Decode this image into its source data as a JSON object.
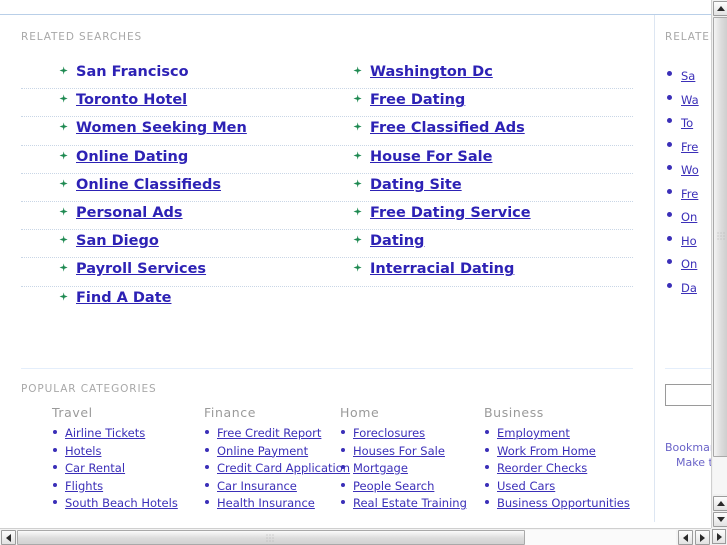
{
  "page": {
    "related_searches_label": "RELATED SEARCHES",
    "popular_categories_label": "POPULAR CATEGORIES"
  },
  "related_searches": {
    "left_column": [
      "San Francisco",
      "Toronto Hotel",
      "Women Seeking Men",
      "Online Dating",
      "Online Classifieds",
      "Personal Ads",
      "San Diego",
      "Payroll Services",
      "Find A Date"
    ],
    "right_column": [
      "Washington Dc",
      "Free Dating",
      "Free Classified Ads",
      "House For Sale",
      "Dating Site",
      "Free Dating Service",
      "Dating",
      "Interracial Dating"
    ]
  },
  "popular_categories": [
    {
      "title": "Travel",
      "items": [
        "Airline Tickets",
        "Hotels",
        "Car Rental",
        "Flights",
        "South Beach Hotels"
      ]
    },
    {
      "title": "Finance",
      "items": [
        "Free Credit Report",
        "Online Payment",
        "Credit Card Application",
        "Car Insurance",
        "Health Insurance"
      ]
    },
    {
      "title": "Home",
      "items": [
        "Foreclosures",
        "Houses For Sale",
        "Mortgage",
        "People Search",
        "Real Estate Training"
      ]
    },
    {
      "title": "Business",
      "items": [
        "Employment",
        "Work From Home",
        "Reorder Checks",
        "Used Cars",
        "Business Opportunities"
      ]
    }
  ],
  "sidebar": {
    "label": "RELATED",
    "items": [
      "Sa",
      "Wa",
      "To",
      "Fre",
      "Wo",
      "Fre",
      "On",
      "Ho",
      "On",
      "Da"
    ],
    "search_value": "",
    "search_placeholder": "",
    "footer_line1": "Bookmark",
    "footer_line2": "Make thi"
  },
  "colors": {
    "link": "#3b2fb8",
    "related_link": "#2d22b5",
    "arrow": "#1f8a52",
    "label_gray": "#a8a8a8",
    "rule_blue": "#b9cfe8",
    "divider": "#e4eefb",
    "dotted_separator": "#c9d6e6"
  },
  "scrollbars": {
    "vertical": {
      "up_icon": "triangle-up-icon",
      "down_icon": "triangle-down-icon",
      "thumb_position_percent": 0
    },
    "horizontal": {
      "left_icon": "triangle-left-icon",
      "right_icon": "triangle-right-icon",
      "thumb_position_percent": 0
    },
    "corner_icon": "triangle-right-icon"
  }
}
